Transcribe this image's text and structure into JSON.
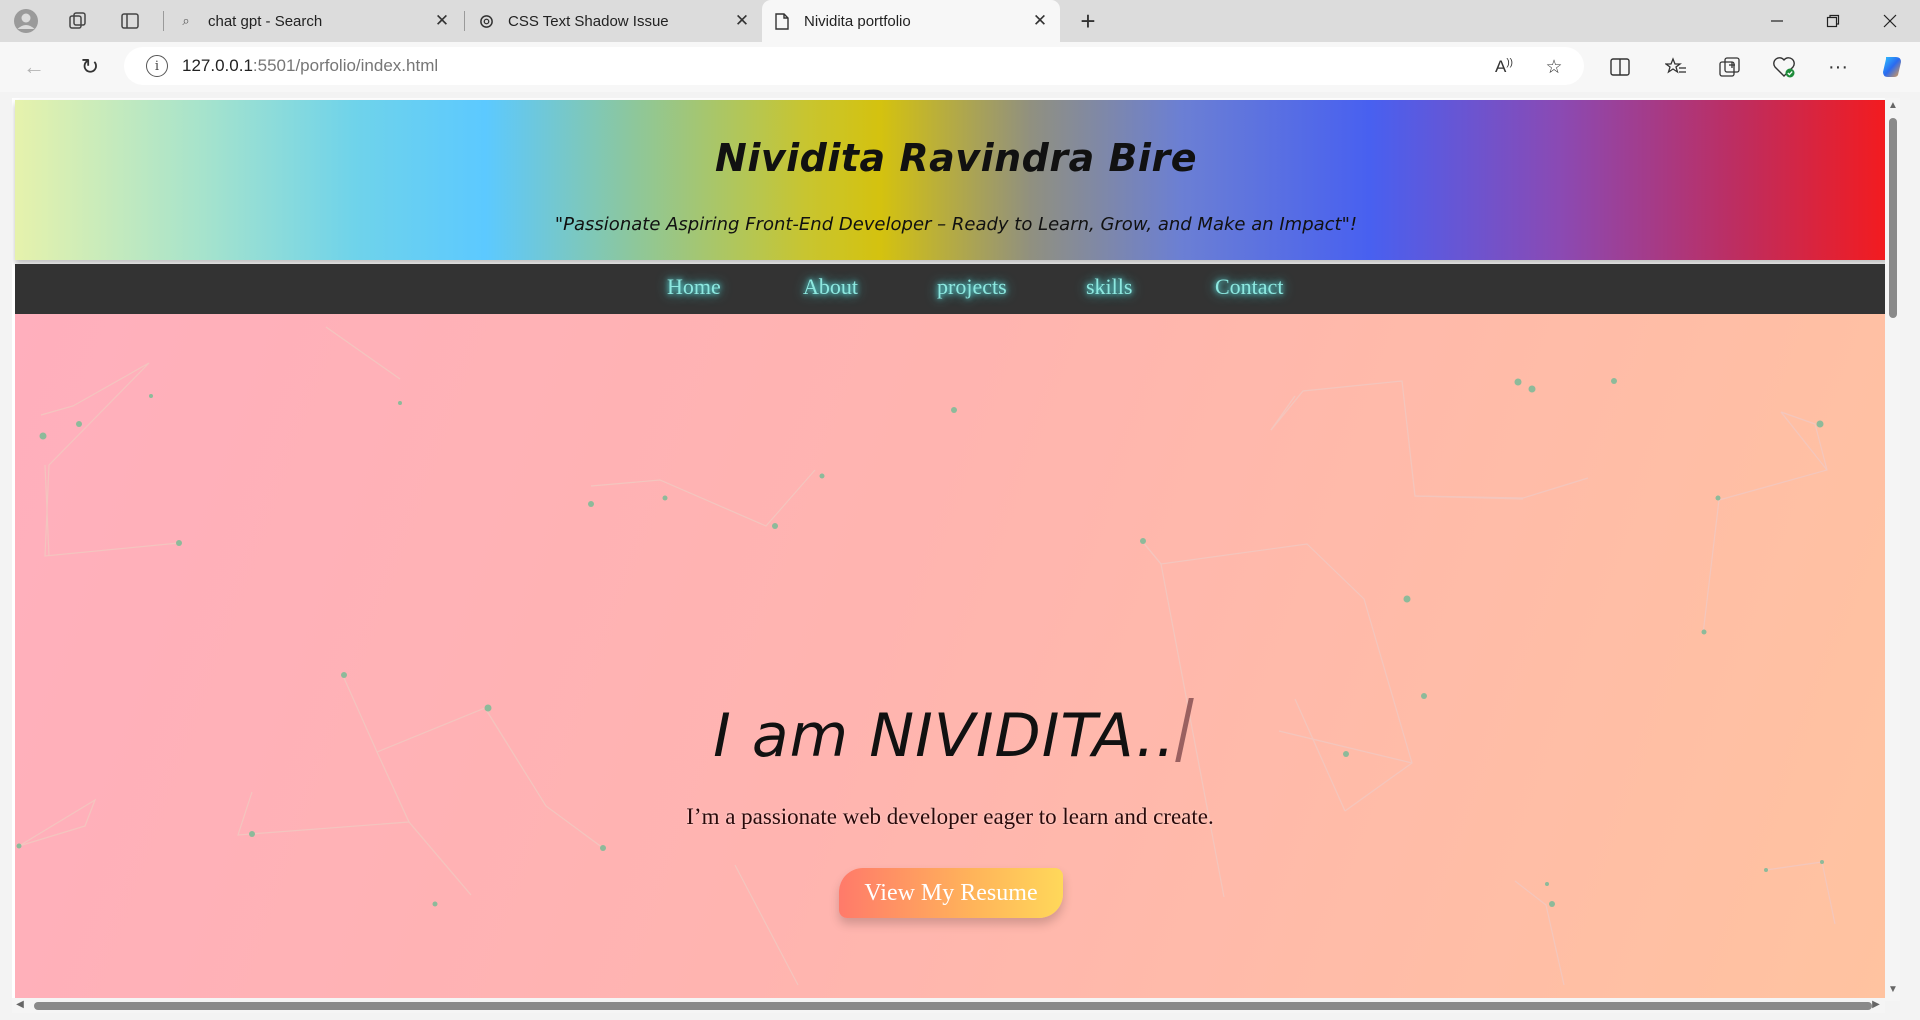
{
  "browser": {
    "tabs": [
      {
        "title": "chat gpt - Search",
        "icon": "search-icon"
      },
      {
        "title": "CSS Text Shadow Issue",
        "icon": "chatgpt-icon"
      },
      {
        "title": "Nividita portfolio",
        "icon": "page-icon",
        "active": true
      }
    ],
    "url": {
      "host": "127.0.0.1",
      "path": ":5501/porfolio/index.html"
    }
  },
  "site": {
    "title": "Nividita Ravindra Bire",
    "tagline": "\"Passionate Aspiring Front-End Developer – Ready to Learn, Grow, and Make an Impact\"!",
    "nav": [
      "Home",
      "About",
      "projects",
      "skills",
      "Contact"
    ],
    "hero": {
      "heading": "I am NIVIDITA..",
      "subtitle": "I’m a passionate web developer eager to learn and create.",
      "cta": "View My Resume"
    }
  },
  "colors": {
    "nav_bg": "#333333",
    "nav_link": "#8de8e0",
    "hero_from": "#ffafbd",
    "hero_to": "#ffc3a0",
    "cta_from": "#ff7a6a",
    "cta_to": "#ffd85a"
  }
}
